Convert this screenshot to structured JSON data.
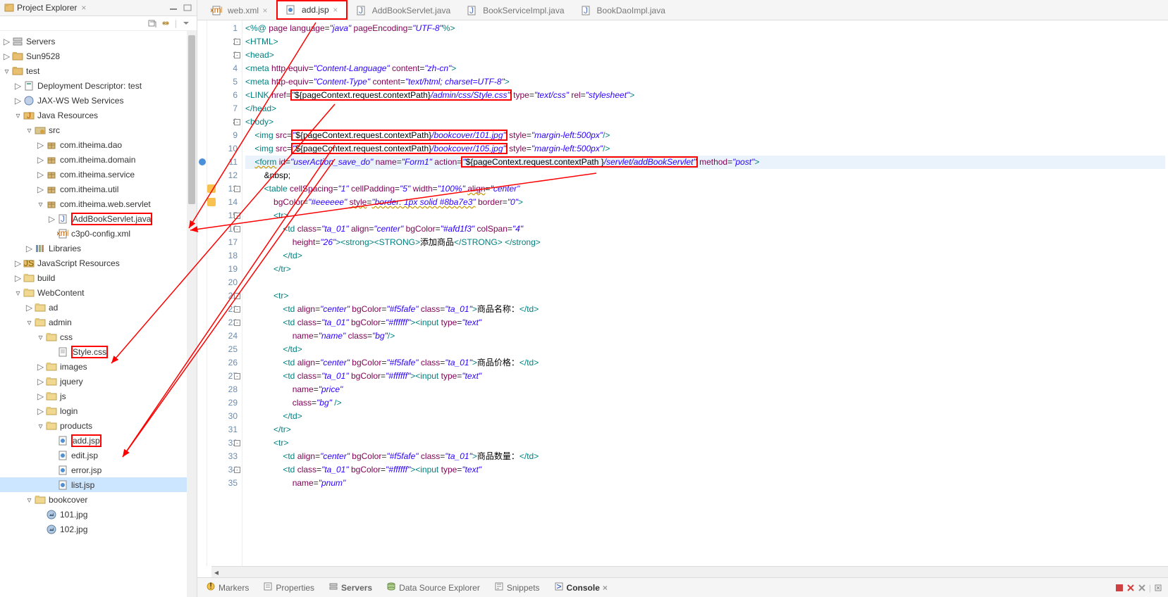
{
  "sidebar": {
    "title": "Project Explorer",
    "close_x": "×",
    "tree": [
      {
        "d": 0,
        "exp": "▷",
        "ik": "server",
        "label": "Servers"
      },
      {
        "d": 0,
        "exp": "▷",
        "ik": "proj",
        "label": "Sun9528"
      },
      {
        "d": 0,
        "exp": "▿",
        "ik": "proj",
        "label": "test"
      },
      {
        "d": 1,
        "exp": "▷",
        "ik": "dd",
        "label": "Deployment Descriptor: test"
      },
      {
        "d": 1,
        "exp": "▷",
        "ik": "jax",
        "label": "JAX-WS Web Services"
      },
      {
        "d": 1,
        "exp": "▿",
        "ik": "jres",
        "label": "Java Resources"
      },
      {
        "d": 2,
        "exp": "▿",
        "ik": "src",
        "label": "src"
      },
      {
        "d": 3,
        "exp": "▷",
        "ik": "pkg",
        "label": "com.itheima.dao"
      },
      {
        "d": 3,
        "exp": "▷",
        "ik": "pkg",
        "label": "com.itheima.domain"
      },
      {
        "d": 3,
        "exp": "▷",
        "ik": "pkg",
        "label": "com.itheima.service"
      },
      {
        "d": 3,
        "exp": "▷",
        "ik": "pkg",
        "label": "com.itheima.util"
      },
      {
        "d": 3,
        "exp": "▿",
        "ik": "pkg",
        "label": "com.itheima.web.servlet"
      },
      {
        "d": 4,
        "exp": "▷",
        "ik": "java",
        "label": "AddBookServlet.java",
        "boxed": true
      },
      {
        "d": 4,
        "exp": " ",
        "ik": "xml",
        "label": "c3p0-config.xml"
      },
      {
        "d": 2,
        "exp": "▷",
        "ik": "lib",
        "label": "Libraries"
      },
      {
        "d": 1,
        "exp": "▷",
        "ik": "jsres",
        "label": "JavaScript Resources"
      },
      {
        "d": 1,
        "exp": "▷",
        "ik": "fld",
        "label": "build"
      },
      {
        "d": 1,
        "exp": "▿",
        "ik": "fld",
        "label": "WebContent"
      },
      {
        "d": 2,
        "exp": "▷",
        "ik": "fld",
        "label": "ad"
      },
      {
        "d": 2,
        "exp": "▿",
        "ik": "fld",
        "label": "admin"
      },
      {
        "d": 3,
        "exp": "▿",
        "ik": "fld",
        "label": "css"
      },
      {
        "d": 4,
        "exp": " ",
        "ik": "file",
        "label": "Style.css",
        "boxed": true
      },
      {
        "d": 3,
        "exp": "▷",
        "ik": "fld",
        "label": "images"
      },
      {
        "d": 3,
        "exp": "▷",
        "ik": "fld",
        "label": "jquery"
      },
      {
        "d": 3,
        "exp": "▷",
        "ik": "fld",
        "label": "js"
      },
      {
        "d": 3,
        "exp": "▷",
        "ik": "fld",
        "label": "login"
      },
      {
        "d": 3,
        "exp": "▿",
        "ik": "fld",
        "label": "products"
      },
      {
        "d": 4,
        "exp": " ",
        "ik": "jsp",
        "label": "add.jsp",
        "boxed": true
      },
      {
        "d": 4,
        "exp": " ",
        "ik": "jsp",
        "label": "edit.jsp"
      },
      {
        "d": 4,
        "exp": " ",
        "ik": "jsp",
        "label": "error.jsp"
      },
      {
        "d": 4,
        "exp": " ",
        "ik": "jsp",
        "label": "list.jsp",
        "selected": true
      },
      {
        "d": 2,
        "exp": "▿",
        "ik": "fld",
        "label": "bookcover"
      },
      {
        "d": 3,
        "exp": " ",
        "ik": "img",
        "label": "101.jpg"
      },
      {
        "d": 3,
        "exp": " ",
        "ik": "img",
        "label": "102.jpg"
      }
    ]
  },
  "tabs": [
    {
      "icon": "xml",
      "label": "web.xml",
      "close": true
    },
    {
      "icon": "jsp",
      "label": "add.jsp",
      "close": true,
      "active": true,
      "boxed": true
    },
    {
      "icon": "java",
      "label": "AddBookServlet.java",
      "close": false
    },
    {
      "icon": "java",
      "label": "BookServiceImpl.java",
      "close": false
    },
    {
      "icon": "java",
      "label": "BookDaoImpl.java",
      "close": false
    }
  ],
  "gutter": [
    {
      "n": 1
    },
    {
      "n": 2,
      "fold": "-"
    },
    {
      "n": 3,
      "fold": "-"
    },
    {
      "n": 4
    },
    {
      "n": 5
    },
    {
      "n": 6
    },
    {
      "n": 7
    },
    {
      "n": 8,
      "fold": "-"
    },
    {
      "n": 9
    },
    {
      "n": 10
    },
    {
      "n": 11,
      "hl": true,
      "break": true
    },
    {
      "n": 12
    },
    {
      "n": 13,
      "warn": true,
      "fold": "-"
    },
    {
      "n": 14,
      "warn": true
    },
    {
      "n": 15,
      "fold": "-"
    },
    {
      "n": 16,
      "fold": "-"
    },
    {
      "n": 17
    },
    {
      "n": 18
    },
    {
      "n": 19
    },
    {
      "n": 20
    },
    {
      "n": 21,
      "fold": "-"
    },
    {
      "n": 22,
      "fold": "-"
    },
    {
      "n": 23,
      "fold": "-"
    },
    {
      "n": 24
    },
    {
      "n": 25
    },
    {
      "n": 26
    },
    {
      "n": 27,
      "fold": "-"
    },
    {
      "n": 28
    },
    {
      "n": 29
    },
    {
      "n": 30
    },
    {
      "n": 31
    },
    {
      "n": 32,
      "fold": "-"
    },
    {
      "n": 33
    },
    {
      "n": 34,
      "fold": "-"
    },
    {
      "n": 35
    }
  ],
  "code_text": {
    "label_add_product": "添加商品",
    "label_product_name": "商品名称：",
    "label_product_price": "商品价格：",
    "label_product_qty": "商品数量：",
    "css_path": "/admin/css/Style.css",
    "img1_path": "/bookcover/101.jpg",
    "img2_path": "/bookcover/105.jpg",
    "servlet_path": "/servlet/addBookServlet"
  },
  "bottom_tabs": [
    {
      "icon": "markers",
      "label": "Markers"
    },
    {
      "icon": "props",
      "label": "Properties"
    },
    {
      "icon": "servers",
      "label": "Servers",
      "bold": true
    },
    {
      "icon": "dse",
      "label": "Data Source Explorer"
    },
    {
      "icon": "snip",
      "label": "Snippets"
    },
    {
      "icon": "console",
      "label": "Console",
      "active": true,
      "closeable": true
    }
  ]
}
